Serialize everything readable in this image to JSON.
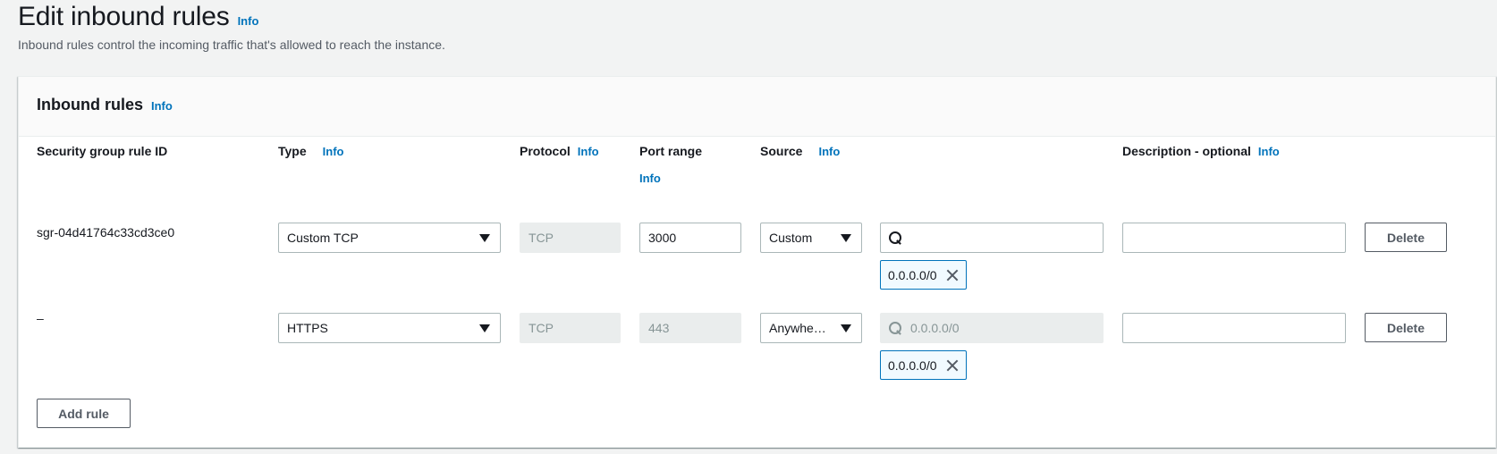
{
  "page": {
    "title": "Edit inbound rules",
    "title_info": "Info",
    "description": "Inbound rules control the incoming traffic that's allowed to reach the instance."
  },
  "panel": {
    "title": "Inbound rules",
    "info": "Info"
  },
  "columns": {
    "rule_id": "Security group rule ID",
    "type": "Type",
    "type_info": "Info",
    "protocol": "Protocol",
    "protocol_info": "Info",
    "port_range": "Port range",
    "port_range_info": "Info",
    "source": "Source",
    "source_info": "Info",
    "description": "Description - optional",
    "description_info": "Info"
  },
  "rules": [
    {
      "rule_id": "sgr-04d41764c33cd3ce0",
      "type": "Custom TCP",
      "protocol": "TCP",
      "port_range": "3000",
      "source_type": "Custom",
      "source_search": "",
      "source_placeholder": "",
      "source_token": "0.0.0.0/0",
      "description": "",
      "delete_label": "Delete"
    },
    {
      "rule_id": "–",
      "type": "HTTPS",
      "protocol": "TCP",
      "port_range": "443",
      "source_type": "Anywhe…",
      "source_search": "",
      "source_placeholder": "0.0.0.0/0",
      "source_token": "0.0.0.0/0",
      "description": "",
      "delete_label": "Delete"
    }
  ],
  "actions": {
    "add_rule": "Add rule"
  }
}
